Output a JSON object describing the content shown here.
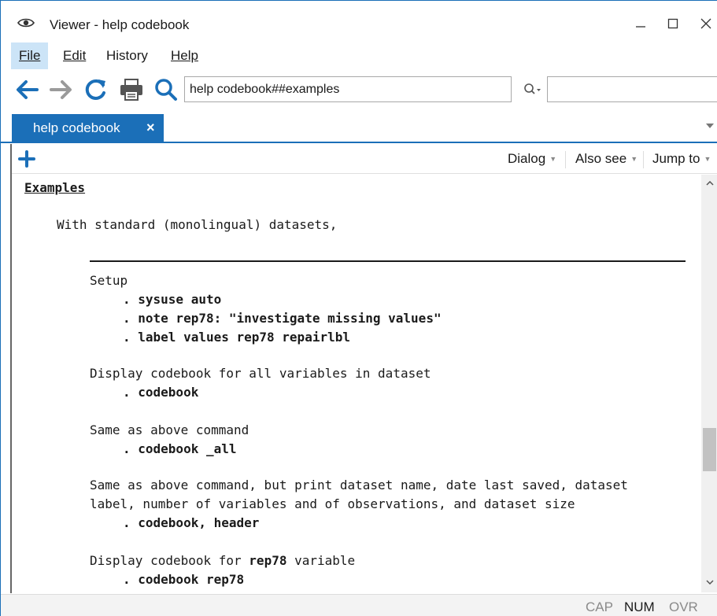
{
  "window": {
    "title": "Viewer - help codebook",
    "icons": [
      "eye-icon",
      "minimize-icon",
      "maximize-icon",
      "close-icon"
    ]
  },
  "menu": {
    "file": "File",
    "edit": "Edit",
    "history": "History",
    "help": "Help"
  },
  "toolbar": {
    "icons": [
      "back-arrow-icon",
      "forward-arrow-icon",
      "refresh-icon",
      "print-icon",
      "search-icon"
    ],
    "address_value": "help codebook##examples",
    "search_placeholder": ""
  },
  "tabs": [
    {
      "label": "help codebook",
      "close": "×"
    }
  ],
  "content_toolbar": {
    "dialog": "Dialog",
    "also_see": "Also see",
    "jump_to": "Jump to"
  },
  "content": {
    "heading": "Examples",
    "intro": "With standard (monolingual) datasets,",
    "sections": [
      {
        "label": "Setup",
        "commands": [
          ". sysuse auto",
          ". note rep78: \"investigate missing values\"",
          ". label values rep78 repairlbl"
        ]
      },
      {
        "label": "Display codebook for all variables in dataset",
        "commands": [
          ". codebook"
        ]
      },
      {
        "label": "Same as above command",
        "commands": [
          ". codebook _all"
        ]
      },
      {
        "label_line1": "Same as above command, but print dataset name, date last saved, dataset",
        "label_line2": "label, number of variables and of observations, and dataset size",
        "commands": [
          ". codebook, header"
        ]
      },
      {
        "label_prefix": "Display codebook for ",
        "label_bold": "rep78",
        "label_suffix": " variable",
        "commands": [
          ". codebook rep78"
        ]
      }
    ]
  },
  "status": {
    "cap": "CAP",
    "num": "NUM",
    "ovr": "OVR"
  },
  "colors": {
    "accent": "#1b6fb8",
    "menu_active": "#cce4f7",
    "status_dim": "#8a8a8a"
  }
}
